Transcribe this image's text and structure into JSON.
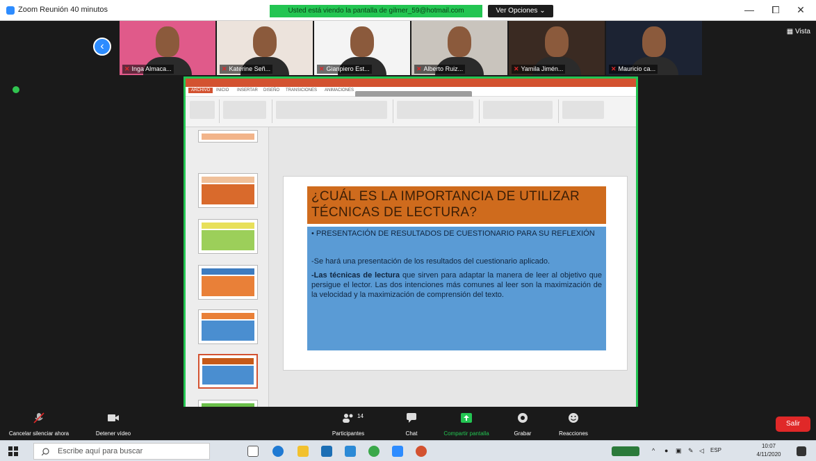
{
  "window": {
    "title": "Zoom Reunión 40 minutos",
    "share_banner": "Usted está viendo la pantalla de gilmer_59@hotmail.com",
    "view_options": "Ver Opciones ⌄",
    "minimize": "—",
    "maximize": "⧠",
    "close": "✕"
  },
  "gallery": {
    "view_label": "▦ Vista",
    "participants": [
      {
        "name": "Inga Almaca...",
        "bg": "#e05a8a"
      },
      {
        "name": "Katerine Señ...",
        "bg": "#ece3dc"
      },
      {
        "name": "Gianpiero Est...",
        "bg": "#f4f4f4"
      },
      {
        "name": "Alberto Ruiz...",
        "bg": "#c9c4bd"
      },
      {
        "name": "Yamila Jimén...",
        "bg": "#3a2a22"
      },
      {
        "name": "Mauricio ca...",
        "bg": "#1c2333"
      }
    ]
  },
  "ppt": {
    "tabs": [
      "ARCHIVO",
      "INICIO",
      "INSERTAR",
      "DISEÑO",
      "TRANSICIONES",
      "ANIMACIONES"
    ],
    "accent": "#d35230",
    "thumbnails": [
      {
        "title_color": "#f2b48a",
        "body_color": "#f2b48a"
      },
      {
        "title_color": "#f0c09a",
        "body_color": "#d96a2c"
      },
      {
        "title_color": "#e8e05a",
        "body_color": "#9ccf5a"
      },
      {
        "title_color": "#3d7cc0",
        "body_color": "#e98038"
      },
      {
        "title_color": "#e98038",
        "body_color": "#4a8ed0"
      },
      {
        "title_color": "#c65a18",
        "body_color": "#4a8ed0"
      },
      {
        "title_color": "#6bbf4a",
        "body_color": "#2f6fb0"
      }
    ],
    "slide": {
      "title": "¿CUÁL ES LA IMPORTANCIA DE UTILIZAR TÉCNICAS DE LECTURA?",
      "bullet": "• PRESENTACIÓN DE RESULTADOS DE CUESTIONARIO PARA SU REFLEXIÓN",
      "p1": "-Se hará una presentación de los resultados del cuestionario aplicado.",
      "p2_bold": "-Las técnicas de lectura",
      "p2_rest": " que sirven para adaptar la manera de leer al objetivo que persigue el lector. Las dos intenciones más comunes al leer son la maximización de la velocidad y la maximización de comprensión del texto."
    }
  },
  "controls": {
    "mute": "Cancelar silenciar ahora",
    "video": "Detener vídeo",
    "participants": "Participantes",
    "participants_count": "14",
    "chat": "Chat",
    "share": "Compartir pantalla",
    "record": "Grabar",
    "reactions": "Reacciones",
    "leave": "Salir"
  },
  "taskbar": {
    "search_placeholder": "Escribe aquí para buscar",
    "language": "ESP",
    "time": "10:07",
    "date": "4/11/2020"
  }
}
